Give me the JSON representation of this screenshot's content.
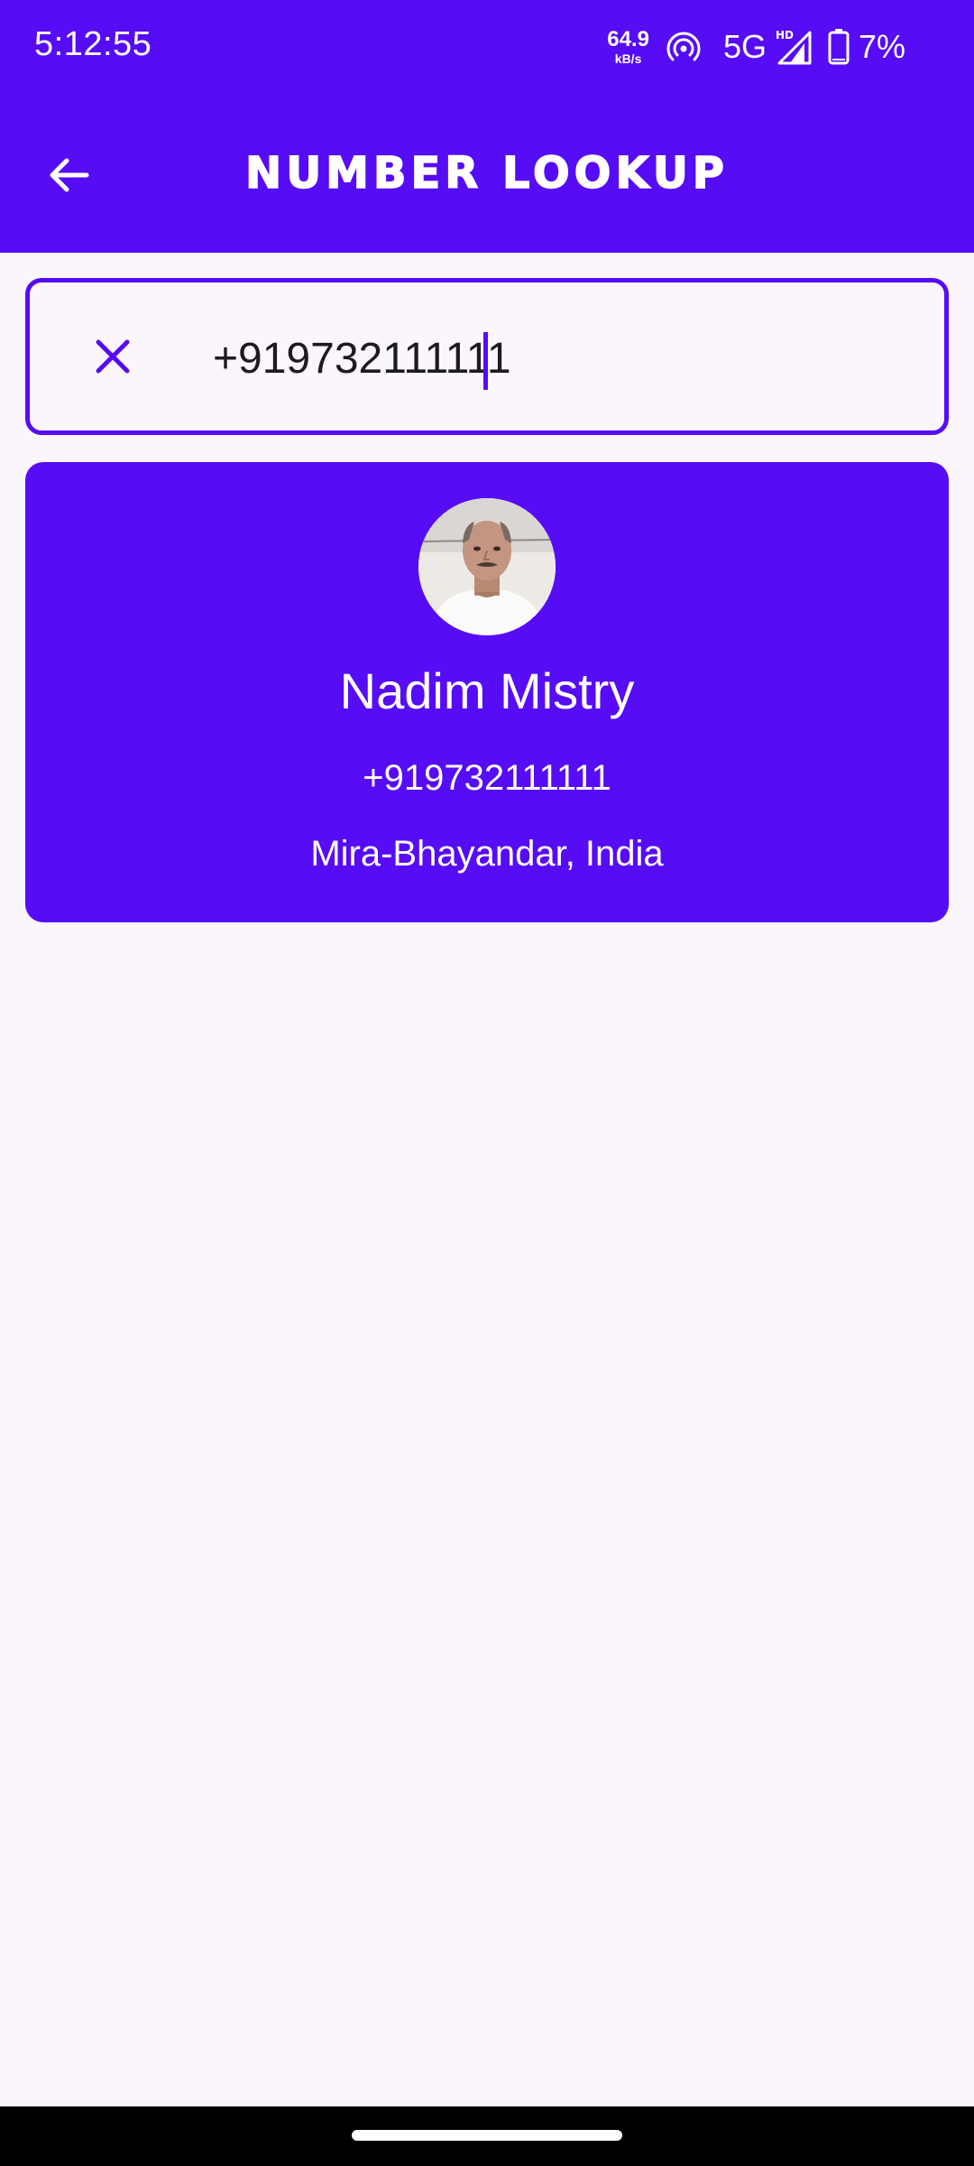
{
  "status_bar": {
    "time": "5:12:55",
    "net_speed_value": "64.9",
    "net_speed_unit": "kB/s",
    "network_type": "5G",
    "battery": "7%",
    "icons": [
      "hotspot-icon",
      "signal-hd-icon",
      "battery-icon"
    ]
  },
  "app_bar": {
    "title": "NUMBER LOOKUP",
    "back_icon": "arrow-back-icon"
  },
  "search": {
    "value": "+919732111111",
    "clear_icon": "close-icon"
  },
  "result": {
    "name": "Nadim Mistry",
    "number": "+919732111111",
    "location": "Mira-Bhayandar, India",
    "avatar": "contact-photo"
  },
  "colors": {
    "primary": "#560CF5",
    "background": "#FBF6FC",
    "on_primary": "#FFFFFF",
    "text": "#1C1B1F"
  }
}
